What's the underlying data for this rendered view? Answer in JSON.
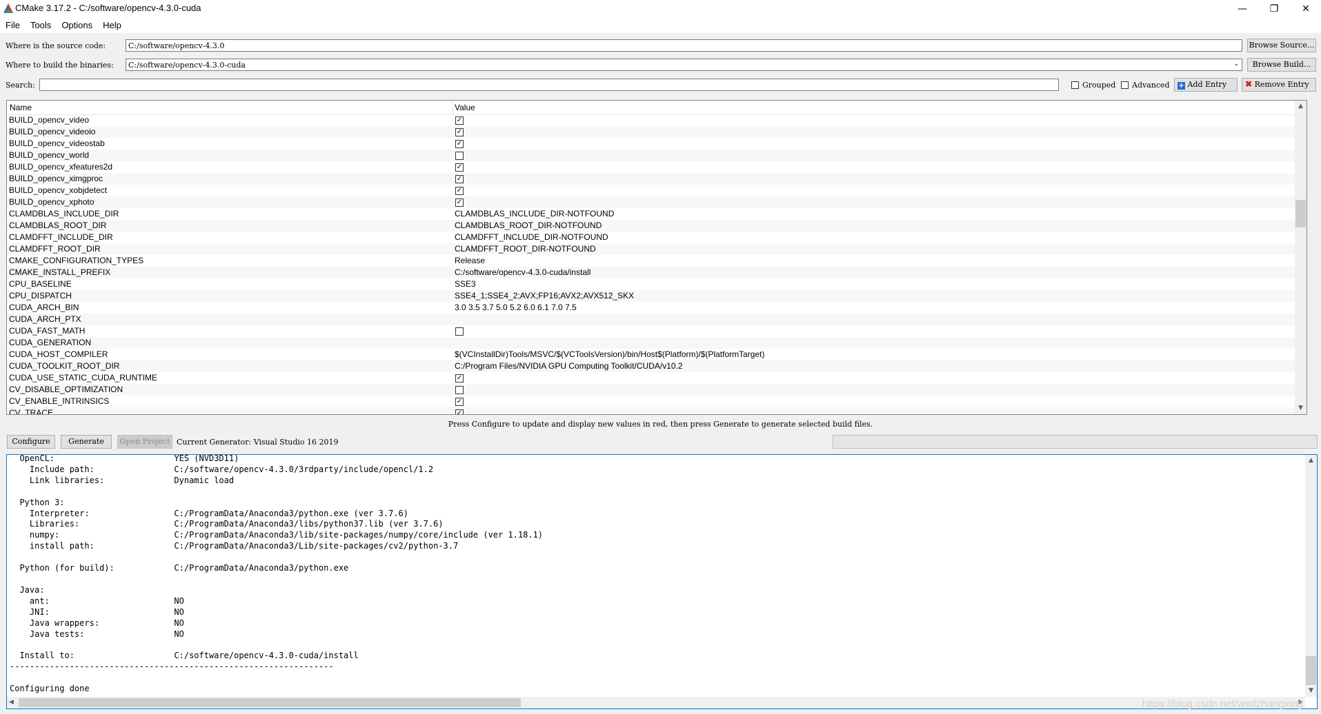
{
  "window": {
    "title": "CMake 3.17.2 - C:/software/opencv-4.3.0-cuda",
    "minimize": "—",
    "restore": "❐",
    "close": "✕"
  },
  "menu": [
    "File",
    "Tools",
    "Options",
    "Help"
  ],
  "source": {
    "label": "Where is the source code:",
    "value": "C:/software/opencv-4.3.0",
    "browse": "Browse Source..."
  },
  "build": {
    "label": "Where to build the binaries:",
    "value": "C:/software/opencv-4.3.0-cuda",
    "browse": "Browse Build..."
  },
  "search": {
    "label": "Search:",
    "value": "",
    "grouped": "Grouped",
    "grouped_checked": false,
    "advanced": "Advanced",
    "advanced_checked": false,
    "add_entry": "Add Entry",
    "remove_entry": "Remove Entry"
  },
  "table": {
    "col_name": "Name",
    "col_value": "Value",
    "rows": [
      {
        "name": "BUILD_opencv_video",
        "type": "bool",
        "checked": true
      },
      {
        "name": "BUILD_opencv_videoio",
        "type": "bool",
        "checked": true
      },
      {
        "name": "BUILD_opencv_videostab",
        "type": "bool",
        "checked": true
      },
      {
        "name": "BUILD_opencv_world",
        "type": "bool",
        "checked": false
      },
      {
        "name": "BUILD_opencv_xfeatures2d",
        "type": "bool",
        "checked": true
      },
      {
        "name": "BUILD_opencv_ximgproc",
        "type": "bool",
        "checked": true
      },
      {
        "name": "BUILD_opencv_xobjdetect",
        "type": "bool",
        "checked": true
      },
      {
        "name": "BUILD_opencv_xphoto",
        "type": "bool",
        "checked": true
      },
      {
        "name": "CLAMDBLAS_INCLUDE_DIR",
        "type": "text",
        "value": "CLAMDBLAS_INCLUDE_DIR-NOTFOUND"
      },
      {
        "name": "CLAMDBLAS_ROOT_DIR",
        "type": "text",
        "value": "CLAMDBLAS_ROOT_DIR-NOTFOUND"
      },
      {
        "name": "CLAMDFFT_INCLUDE_DIR",
        "type": "text",
        "value": "CLAMDFFT_INCLUDE_DIR-NOTFOUND"
      },
      {
        "name": "CLAMDFFT_ROOT_DIR",
        "type": "text",
        "value": "CLAMDFFT_ROOT_DIR-NOTFOUND"
      },
      {
        "name": "CMAKE_CONFIGURATION_TYPES",
        "type": "text",
        "value": "Release"
      },
      {
        "name": "CMAKE_INSTALL_PREFIX",
        "type": "text",
        "value": "C:/software/opencv-4.3.0-cuda/install"
      },
      {
        "name": "CPU_BASELINE",
        "type": "text",
        "value": "SSE3"
      },
      {
        "name": "CPU_DISPATCH",
        "type": "text",
        "value": "SSE4_1;SSE4_2;AVX;FP16;AVX2;AVX512_SKX"
      },
      {
        "name": "CUDA_ARCH_BIN",
        "type": "text",
        "value": "3.0 3.5 3.7 5.0 5.2 6.0 6.1 7.0 7.5"
      },
      {
        "name": "CUDA_ARCH_PTX",
        "type": "text",
        "value": ""
      },
      {
        "name": "CUDA_FAST_MATH",
        "type": "bool",
        "checked": false
      },
      {
        "name": "CUDA_GENERATION",
        "type": "text",
        "value": ""
      },
      {
        "name": "CUDA_HOST_COMPILER",
        "type": "text",
        "value": "$(VCInstallDir)Tools/MSVC/$(VCToolsVersion)/bin/Host$(Platform)/$(PlatformTarget)"
      },
      {
        "name": "CUDA_TOOLKIT_ROOT_DIR",
        "type": "text",
        "value": "C:/Program Files/NVIDIA GPU Computing Toolkit/CUDA/v10.2"
      },
      {
        "name": "CUDA_USE_STATIC_CUDA_RUNTIME",
        "type": "bool",
        "checked": true
      },
      {
        "name": "CV_DISABLE_OPTIMIZATION",
        "type": "bool",
        "checked": false
      },
      {
        "name": "CV_ENABLE_INTRINSICS",
        "type": "bool",
        "checked": true
      },
      {
        "name": "CV_TRACE",
        "type": "bool",
        "checked": true
      }
    ]
  },
  "hint": "Press Configure to update and display new values in red, then press Generate to generate selected build files.",
  "actions": {
    "configure": "Configure",
    "generate": "Generate",
    "open_project": "Open Project",
    "generator": "Current Generator: Visual Studio 16 2019"
  },
  "output": {
    "lines": [
      "  OpenCL:                        YES (NVD3D11)",
      "    Include path:                C:/software/opencv-4.3.0/3rdparty/include/opencl/1.2",
      "    Link libraries:              Dynamic load",
      "",
      "  Python 3:",
      "    Interpreter:                 C:/ProgramData/Anaconda3/python.exe (ver 3.7.6)",
      "    Libraries:                   C:/ProgramData/Anaconda3/libs/python37.lib (ver 3.7.6)",
      "    numpy:                       C:/ProgramData/Anaconda3/lib/site-packages/numpy/core/include (ver 1.18.1)",
      "    install path:                C:/ProgramData/Anaconda3/Lib/site-packages/cv2/python-3.7",
      "",
      "  Python (for build):            C:/ProgramData/Anaconda3/python.exe",
      "",
      "  Java:",
      "    ant:                         NO",
      "    JNI:                         NO",
      "    Java wrappers:               NO",
      "    Java tests:                  NO",
      "",
      "  Install to:                    C:/software/opencv-4.3.0-cuda/install",
      "-----------------------------------------------------------------",
      "",
      "Configuring done"
    ]
  },
  "watermark": "https://blog.csdn.net/wxdzhangxing"
}
